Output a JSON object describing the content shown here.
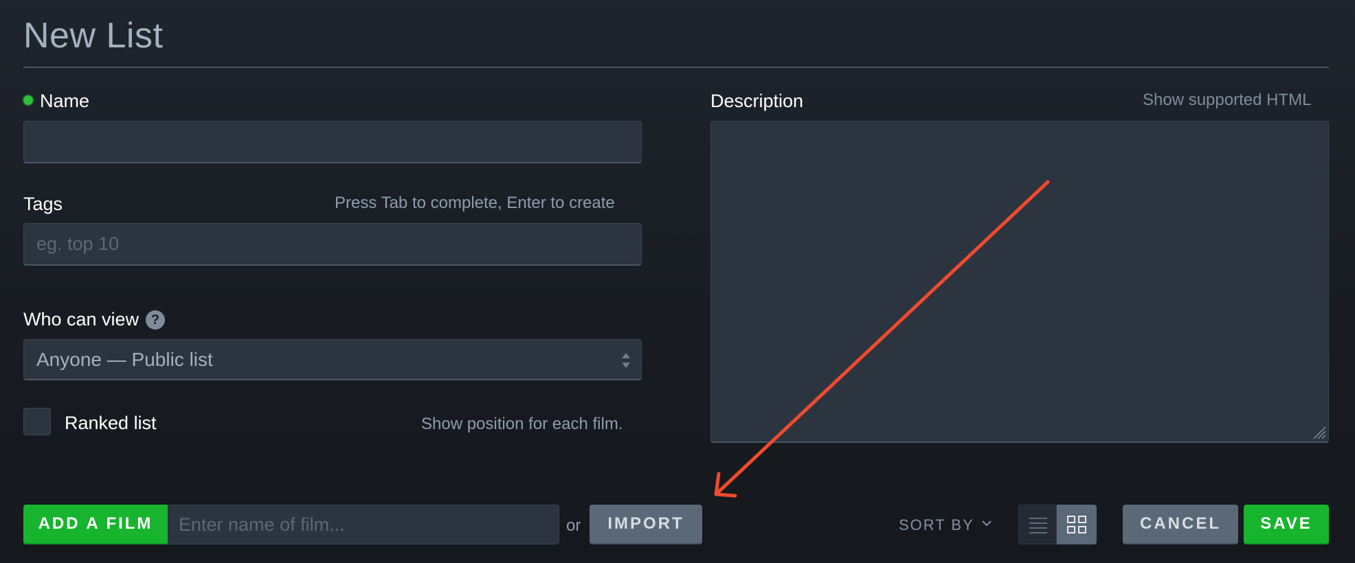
{
  "page": {
    "title": "New List"
  },
  "form": {
    "name": {
      "label": "Name",
      "value": ""
    },
    "tags": {
      "label": "Tags",
      "hint": "Press Tab to complete, Enter to create",
      "placeholder": "eg. top 10"
    },
    "visibility": {
      "label": "Who can view",
      "help_glyph": "?",
      "selected": "Anyone — Public list"
    },
    "ranked": {
      "label": "Ranked list",
      "hint": "Show position for each film.",
      "checked": false
    },
    "description": {
      "label": "Description",
      "link": "Show supported HTML",
      "value": ""
    }
  },
  "toolbar": {
    "add_film_label": "ADD A FILM",
    "film_placeholder": "Enter name of film...",
    "or_text": "or",
    "import_label": "IMPORT",
    "sort_by_label": "SORT BY",
    "view_modes": [
      "list-view-icon",
      "grid-view-icon"
    ],
    "active_view": "grid",
    "cancel_label": "CANCEL",
    "save_label": "SAVE"
  },
  "colors": {
    "accent_green": "#17b52d",
    "required_dot": "#2cc13a",
    "annotation_arrow": "#f04a2c"
  }
}
